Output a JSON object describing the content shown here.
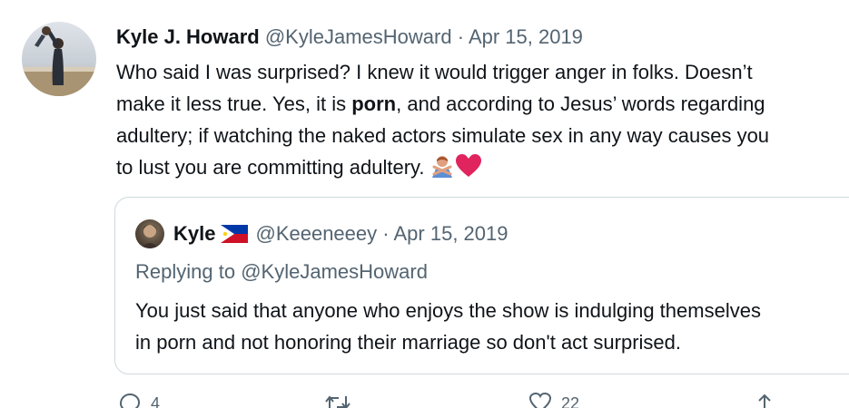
{
  "tweet": {
    "display_name": "Kyle J. Howard",
    "handle": "@KyleJamesHoward",
    "separator": "·",
    "date": "Apr 15, 2019",
    "text_lines": [
      "Who said I was surprised? I knew it would trigger anger in folks. Doesn’t",
      "make it less true. Yes, it is",
      "porn",
      ", and according to Jesus’ words regarding",
      "adultery; if watching the naked actors simulate sex in any way causes you",
      "to lust you are committing adultery."
    ],
    "emojis": [
      "person-gesturing-no-icon",
      "red-heart-icon"
    ]
  },
  "quoted_tweet": {
    "display_name": "Kyle",
    "flag": "philippines-flag-icon",
    "handle": "@Keeeneeey",
    "separator": "·",
    "date": "Apr 15, 2019",
    "replying_prefix": "Replying to",
    "replying_handle": "@KyleJamesHoward",
    "text_lines": [
      "You just said that anyone who enjoys the show is indulging themselves",
      "in porn and not honoring their marriage so don't act surprised."
    ]
  },
  "actions": {
    "reply_count": "4",
    "like_count": "22"
  },
  "colors": {
    "text": "#0f1419",
    "muted": "#536471",
    "border": "#cfd9de",
    "heart": "#e0245e"
  }
}
